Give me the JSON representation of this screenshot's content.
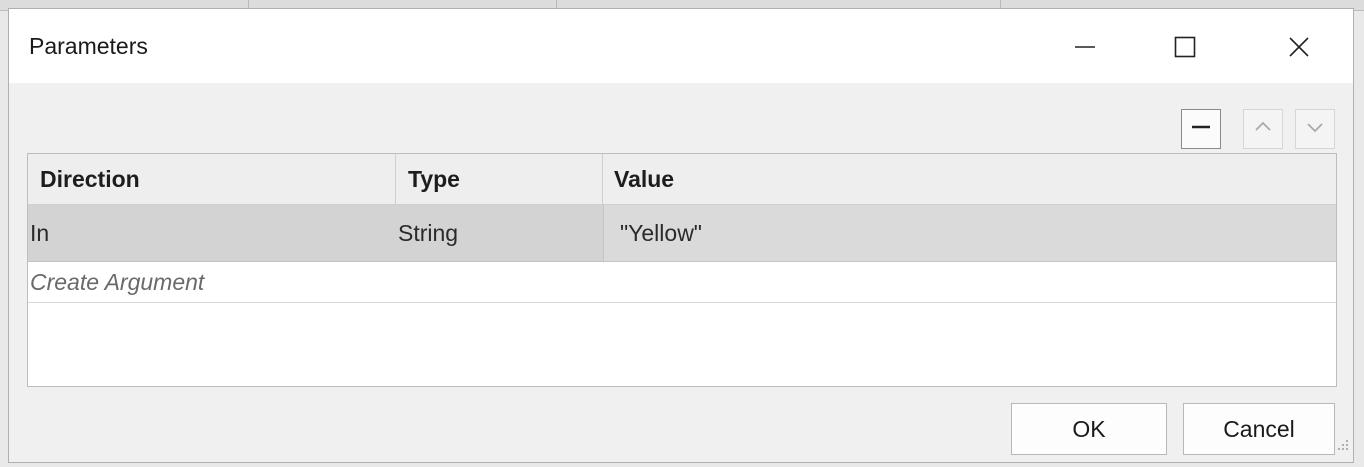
{
  "window": {
    "title": "Parameters",
    "controls": {
      "minimize_icon": "minimize-icon",
      "maximize_icon": "maximize-icon",
      "close_icon": "close-icon"
    }
  },
  "toolbar": {
    "remove_icon": "minus-icon",
    "move_up_icon": "chevron-up-icon",
    "move_down_icon": "chevron-down-icon"
  },
  "grid": {
    "columns": [
      "Direction",
      "Type",
      "Value"
    ],
    "rows": [
      {
        "direction": "In",
        "type": "String",
        "value": "\"Yellow\""
      }
    ],
    "create_placeholder": "Create Argument"
  },
  "footer": {
    "ok_label": "OK",
    "cancel_label": "Cancel"
  },
  "colors": {
    "selected_row": "#d3d3d3",
    "header_bg": "#eeeeee",
    "window_bg": "#f0f0f0"
  }
}
